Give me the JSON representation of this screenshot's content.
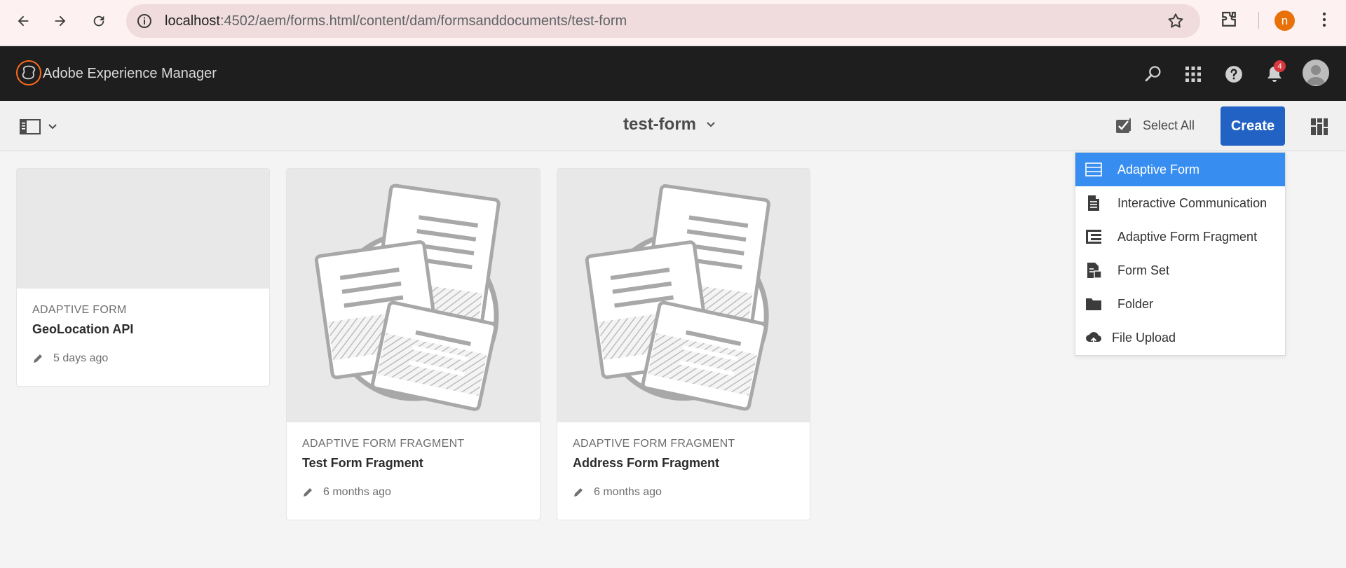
{
  "browser": {
    "url_host": "localhost",
    "url_path": ":4502/aem/forms.html/content/dam/formsanddocuments/test-form",
    "profile_initial": "n"
  },
  "header": {
    "app_title": "Adobe Experience Manager",
    "notification_count": "4"
  },
  "toolbar": {
    "page_title": "test-form",
    "select_all_label": "Select All",
    "create_label": "Create"
  },
  "cards": [
    {
      "type": "ADAPTIVE FORM",
      "title": "GeoLocation API",
      "modified": "5 days ago"
    },
    {
      "type": "ADAPTIVE FORM FRAGMENT",
      "title": "Test Form Fragment",
      "modified": "6 months ago"
    },
    {
      "type": "ADAPTIVE FORM FRAGMENT",
      "title": "Address Form Fragment",
      "modified": "6 months ago"
    }
  ],
  "create_menu": {
    "items": [
      {
        "label": "Adaptive Form",
        "icon": "adaptive-form-icon",
        "active": true
      },
      {
        "label": "Interactive Communication",
        "icon": "document-icon"
      },
      {
        "label": "Adaptive Form Fragment",
        "icon": "form-fragment-icon"
      },
      {
        "label": "Form Set",
        "icon": "form-set-icon"
      },
      {
        "label": "Folder",
        "icon": "folder-icon"
      },
      {
        "label": "File Upload",
        "icon": "cloud-upload-icon"
      }
    ]
  },
  "colors": {
    "header_bg": "#1e1e1e",
    "create_button": "#2262c4",
    "menu_active": "#378ef0",
    "badge": "#d7373f",
    "profile": "#e8710a"
  }
}
